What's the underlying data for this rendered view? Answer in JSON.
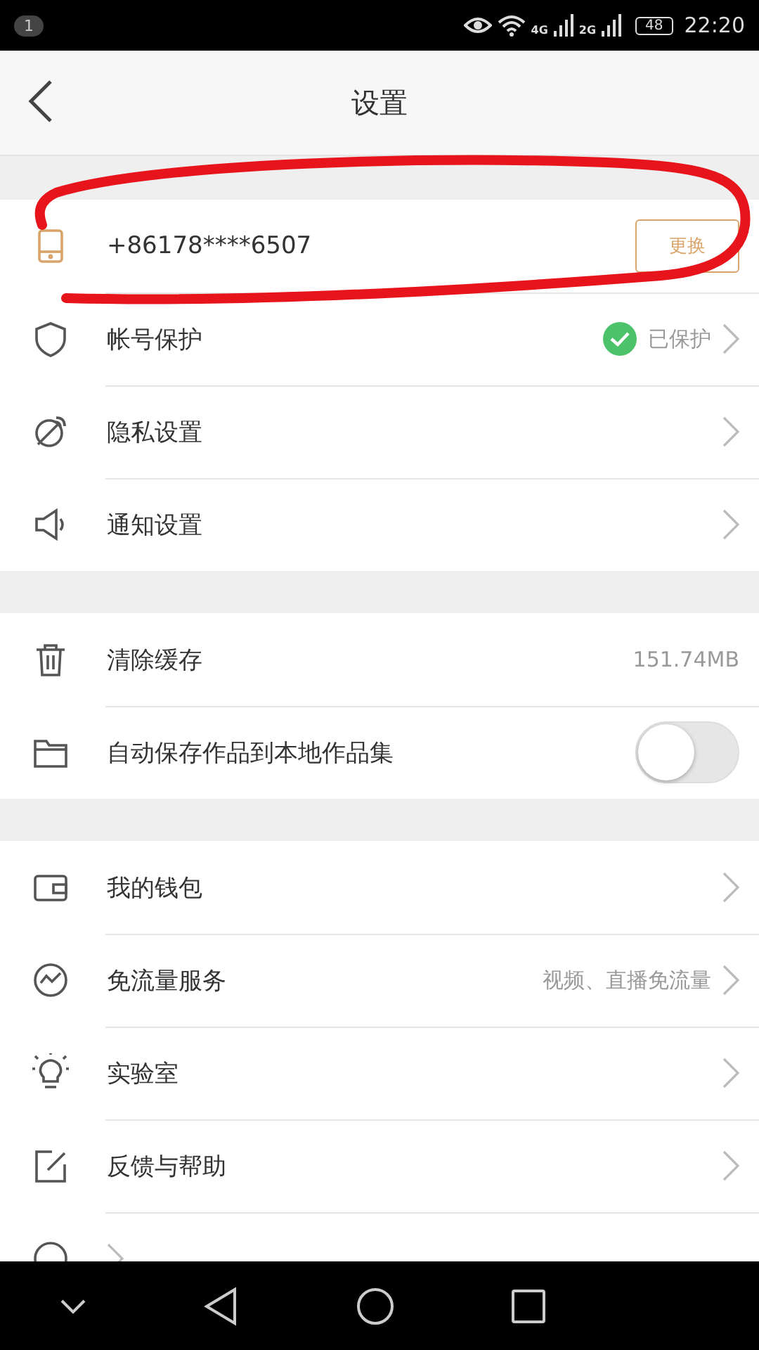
{
  "status_bar": {
    "notification_count": "1",
    "network_1": "4G",
    "network_2": "2G",
    "battery": "48",
    "time": "22:20"
  },
  "header": {
    "title": "设置"
  },
  "sections": [
    {
      "rows": [
        {
          "kind": "phone",
          "label": "+86178****6507",
          "button": "更换"
        },
        {
          "kind": "link",
          "label": "帐号保护",
          "value": "已保护",
          "protected": true
        },
        {
          "kind": "link",
          "label": "隐私设置"
        },
        {
          "kind": "link",
          "label": "通知设置"
        }
      ]
    },
    {
      "rows": [
        {
          "kind": "info",
          "label": "清除缓存",
          "value": "151.74MB"
        },
        {
          "kind": "toggle",
          "label": "自动保存作品到本地作品集",
          "on": false
        }
      ]
    },
    {
      "rows": [
        {
          "kind": "link",
          "label": "我的钱包"
        },
        {
          "kind": "link",
          "label": "免流量服务",
          "value": "视频、直播免流量"
        },
        {
          "kind": "link",
          "label": "实验室"
        },
        {
          "kind": "link",
          "label": "反馈与帮助"
        },
        {
          "kind": "cut"
        }
      ]
    }
  ]
}
